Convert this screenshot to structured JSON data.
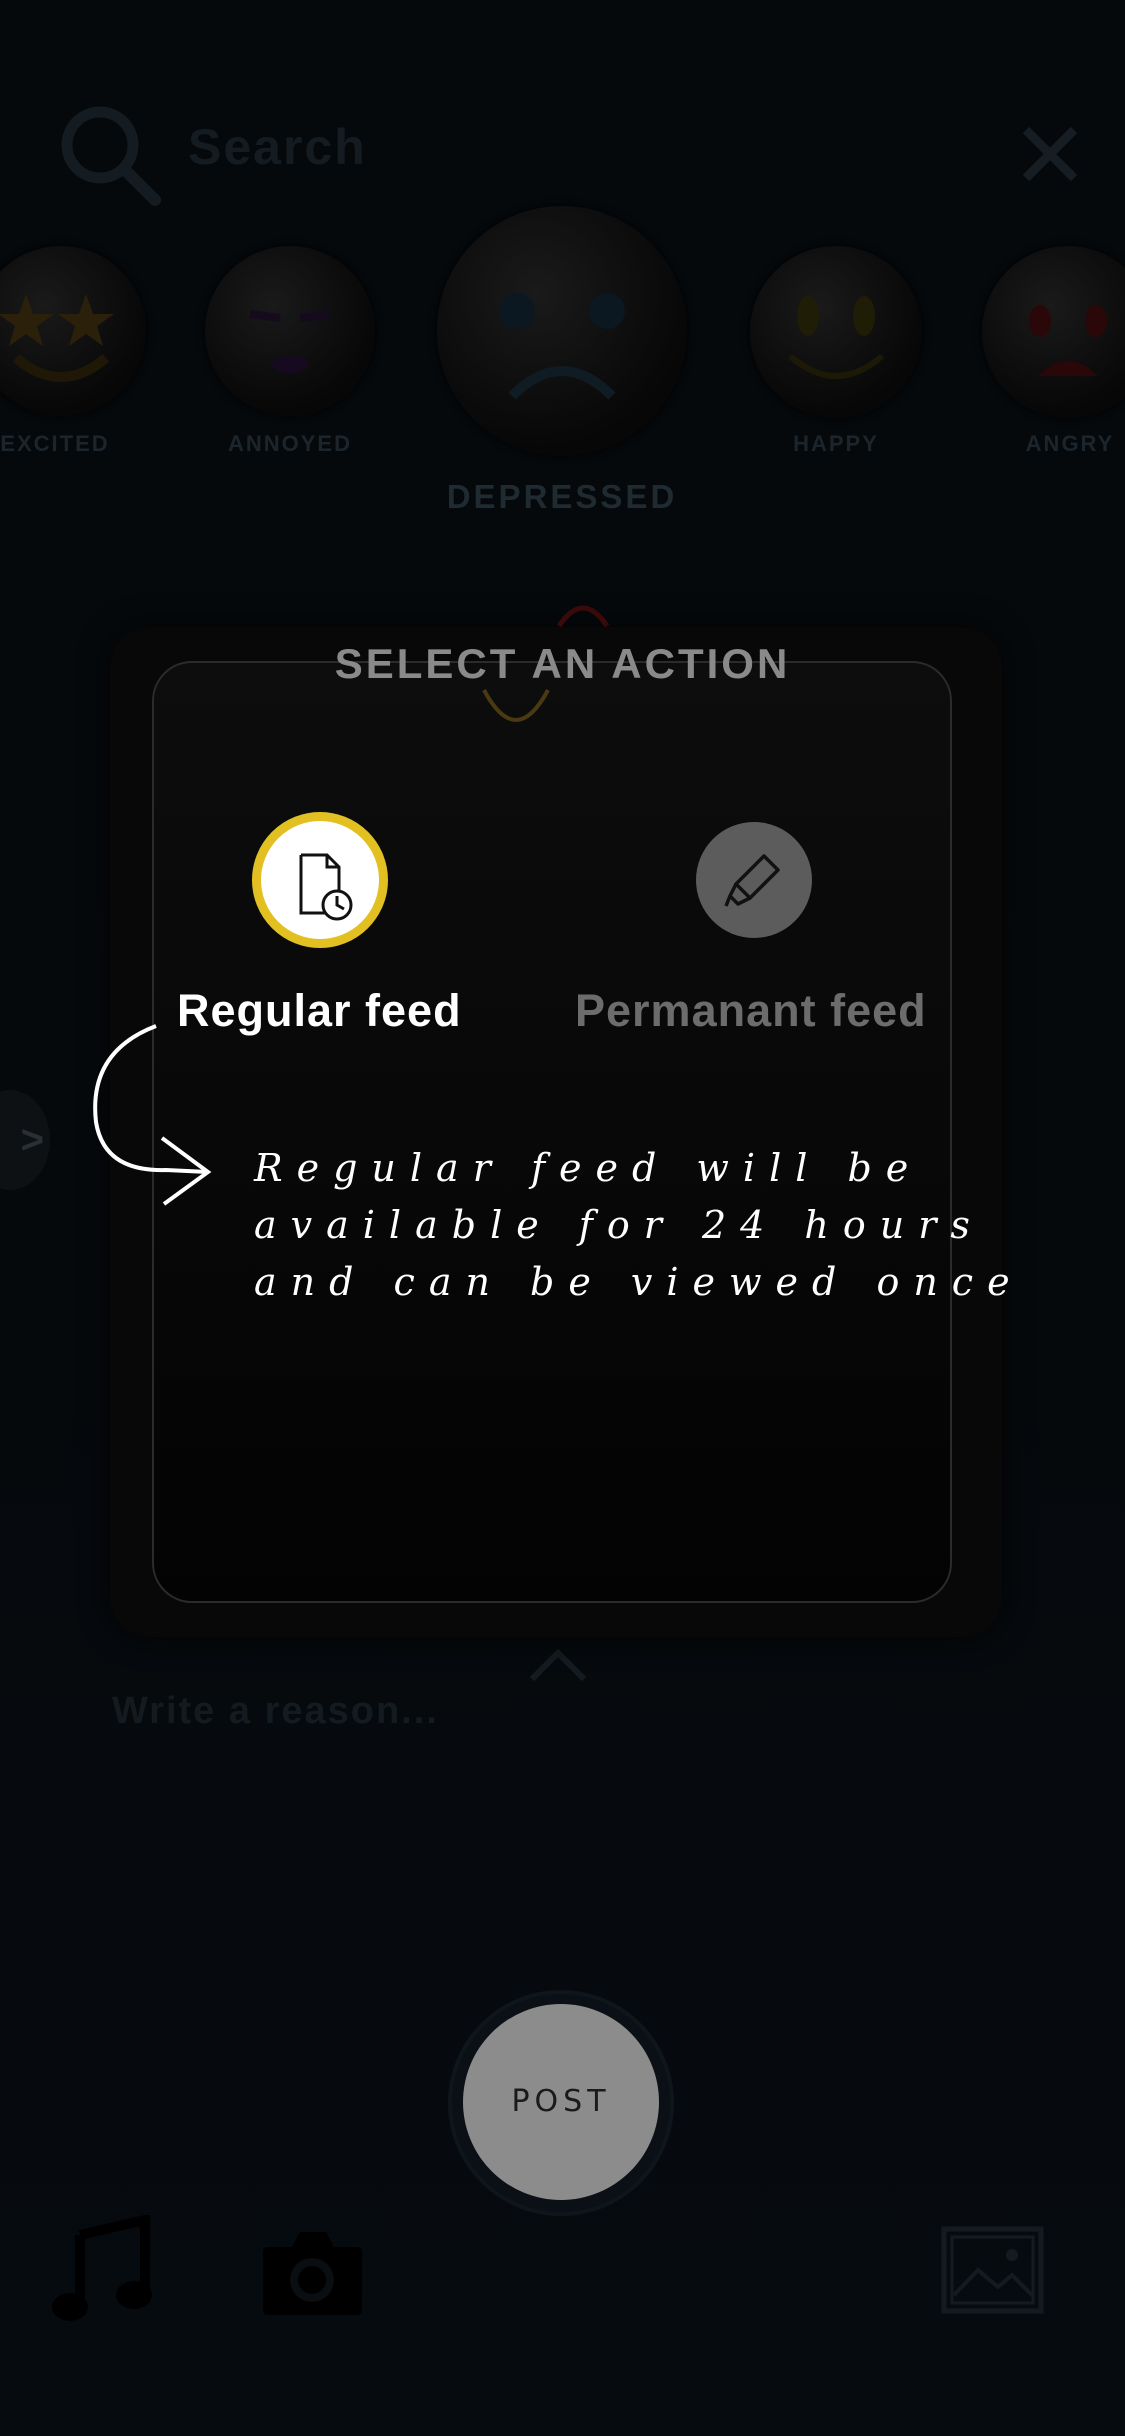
{
  "search": {
    "placeholder": "Search"
  },
  "moods": [
    {
      "label": "EXCITED",
      "face": "star-eyes-face-icon"
    },
    {
      "label": "ANNOYED",
      "face": "annoyed-face-icon"
    },
    {
      "label": "DEPRESSED",
      "face": "sad-face-icon",
      "selected": true
    },
    {
      "label": "HAPPY",
      "face": "smiling-face-icon"
    },
    {
      "label": "ANGRY",
      "face": "angry-face-icon"
    }
  ],
  "side_arrow": ">",
  "modal": {
    "title": "SELECT AN ACTION",
    "options": [
      {
        "label": "Regular feed",
        "icon": "document-clock-icon",
        "selected": true,
        "accent": "#e2c022"
      },
      {
        "label": "Permanant feed",
        "icon": "marker-pen-icon",
        "selected": false
      }
    ],
    "hint_lines": [
      "Regular feed will be",
      "available for 24 hours",
      "and can be viewed once"
    ]
  },
  "reason": {
    "placeholder": "Write a reason..."
  },
  "post": {
    "label": "POST"
  },
  "toolbar": [
    "music-note-icon",
    "camera-icon",
    "gallery-icon"
  ]
}
